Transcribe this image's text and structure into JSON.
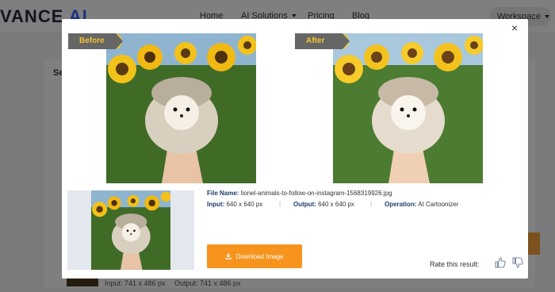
{
  "site": {
    "logo_main": "VANCE",
    "logo_ai": "AI",
    "nav": [
      "Home",
      "AI Solutions",
      "Pricing",
      "Blog"
    ],
    "workspace": "Workspace",
    "section_partial": "Se",
    "bg_input": "Input: 741 x 486 px",
    "bg_output": "Output: 741 x 486 px"
  },
  "modal": {
    "close_symbol": "×",
    "before_label": "Before",
    "after_label": "After",
    "file_name_label": "File Name:",
    "file_name": "lionel-animals-to-follow-on-instagram-1568319926.jpg",
    "input_label": "Input:",
    "input_value": "640 x 640 px",
    "output_label": "Output:",
    "output_value": "640 x 640 px",
    "operation_label": "Operation:",
    "operation_value": "AI Cartoonizer",
    "download_label": "Download Image",
    "rate_label": "Rate this result:"
  },
  "colors": {
    "accent": "#f7941d",
    "label_blue": "#1f3c68",
    "tag_text": "#f4c430",
    "logo_ai": "#3b68ff"
  },
  "icons": [
    "close-icon",
    "download-icon",
    "thumbs-up-icon",
    "thumbs-down-icon",
    "chevron-down-icon"
  ]
}
